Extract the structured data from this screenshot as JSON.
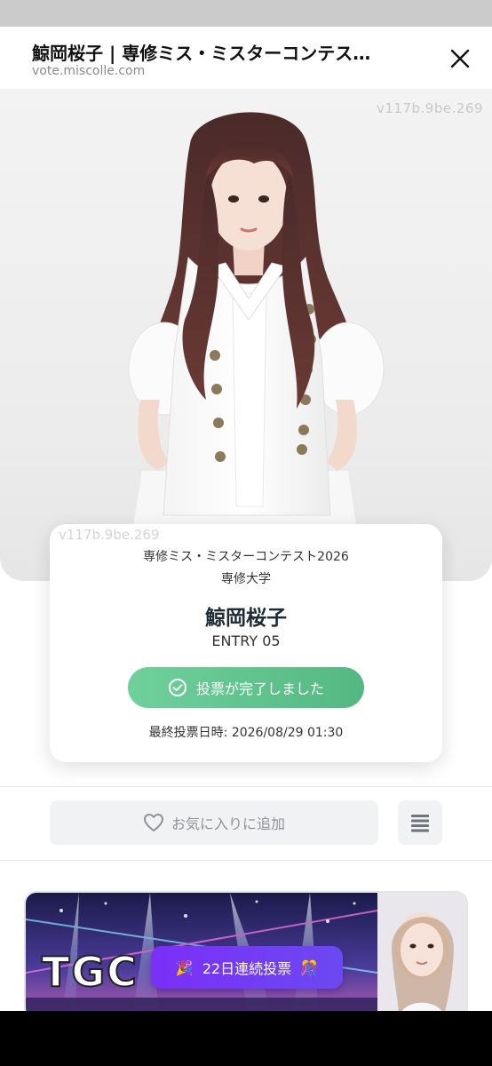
{
  "header": {
    "title": "鯨岡桜子 | 専修ミス・ミスターコンテス…",
    "url": "vote.miscolle.com",
    "close_icon": "close-icon"
  },
  "hero": {
    "watermark": "v117b.9be.269"
  },
  "profile_card": {
    "watermark": "v117b.9be.269",
    "contest": "専修ミス・ミスターコンテスト2026",
    "school": "専修大学",
    "name": "鯨岡桜子",
    "entry": "ENTRY 05",
    "vote_button_label": "投票が完了しました",
    "vote_button_icon": "check-circle-icon",
    "last_vote": "最終投票日時: 2026/08/29 01:30"
  },
  "actions": {
    "favorite_label": "お気に入りに追加",
    "favorite_icon": "heart-icon",
    "menu_icon": "menu-icon"
  },
  "banner": {
    "logo_text": "TGC",
    "streak_label": "22日連続投票",
    "streak_icon_left": "🎉",
    "streak_icon_right": "🎊"
  },
  "colors": {
    "accent_green": "#5cc08c",
    "badge_purple": "#7b2ff7",
    "title_text": "#111111"
  }
}
